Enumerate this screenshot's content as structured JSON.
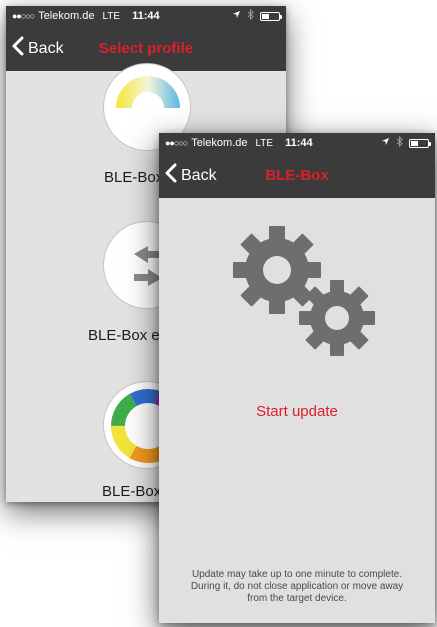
{
  "back_screen": {
    "status_bar": {
      "signal": "●●○○○",
      "carrier": "Telekom.de",
      "network": "LTE",
      "time": "11:44"
    },
    "nav": {
      "back_label": "Back",
      "title": "Select profile"
    },
    "profiles": [
      {
        "label": "BLE-Box",
        "icon": "white-warm-wheel-icon"
      },
      {
        "label": "BLE-Box e",
        "icon": "switch-arrows-icon"
      },
      {
        "label": "BLE-Box",
        "icon": "rgb-wheel-icon"
      }
    ]
  },
  "front_screen": {
    "status_bar": {
      "signal": "●●○○○",
      "carrier": "Telekom.de",
      "network": "LTE",
      "time": "11:44"
    },
    "nav": {
      "back_label": "Back",
      "title": "BLE-Box"
    },
    "action_label": "Start update",
    "info_line1": "Update may take up to one minute to complete.",
    "info_line2": "During it, do not close application or move away",
    "info_line3": "from the target device."
  },
  "colors": {
    "bar_background": "#3b3b3b",
    "accent_red": "#d9202c",
    "screen_background": "#e0e0e0",
    "gear_gray": "#6e6e6e"
  }
}
